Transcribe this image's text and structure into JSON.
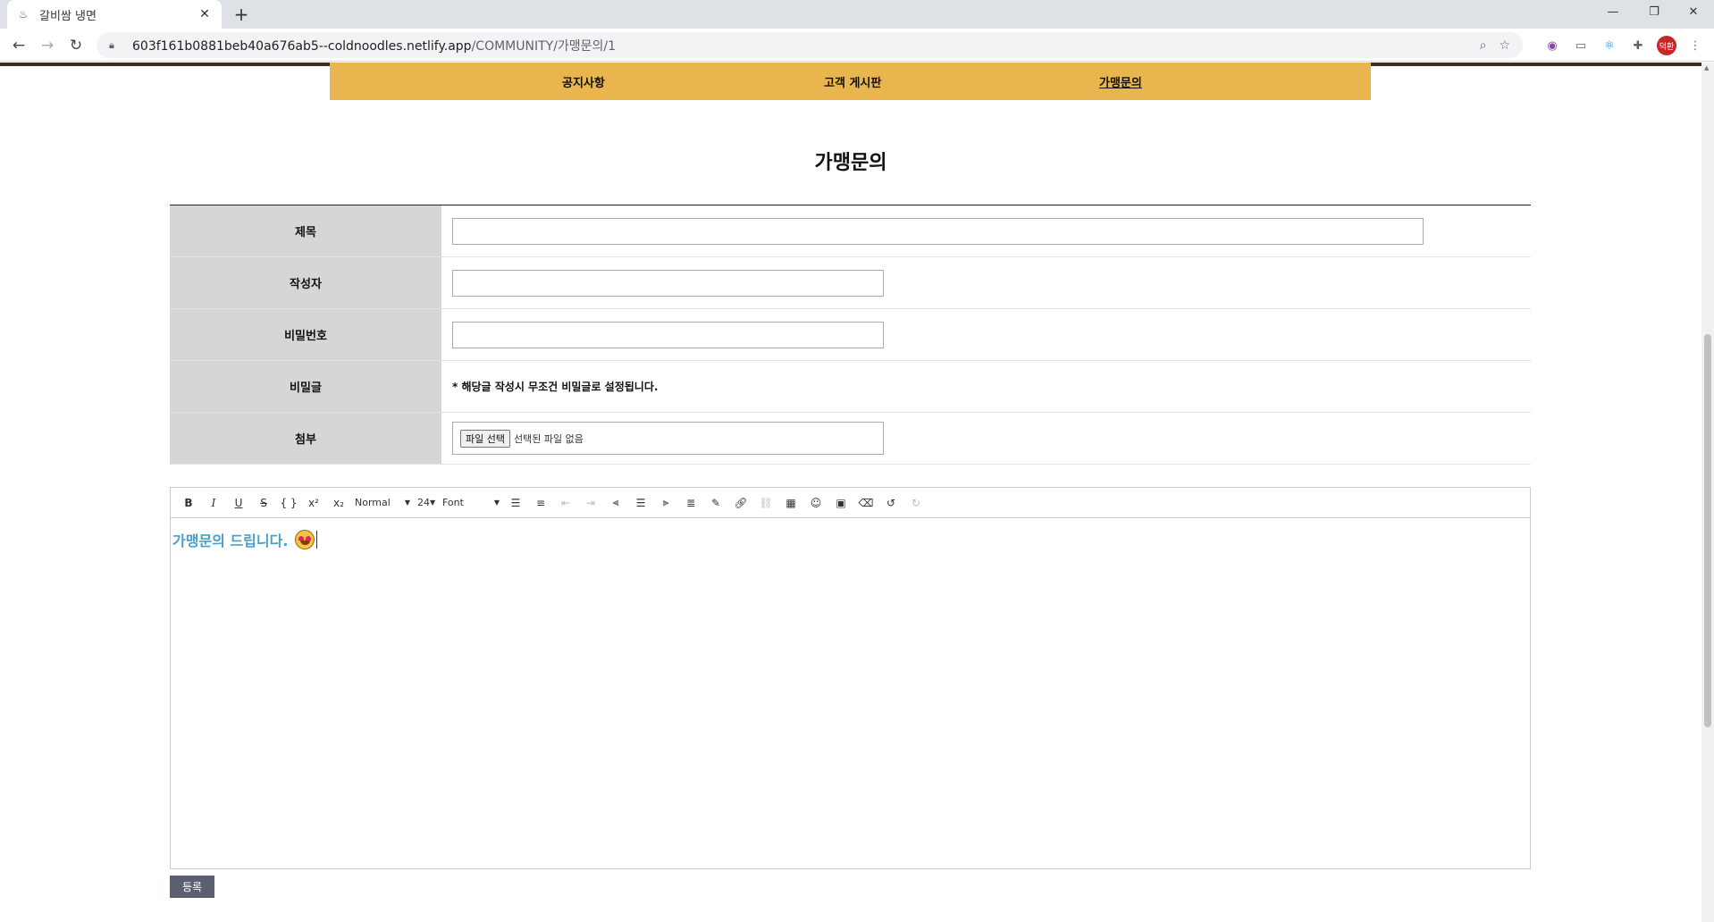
{
  "browser": {
    "tab_title": "갈비쌈 냉면",
    "url_domain": "603f161b0881beb40a676ab5--coldnoodles.netlify.app",
    "url_path": "/COMMUNITY/가맹문의/1",
    "profile_label": "덕환"
  },
  "subnav": {
    "items": [
      {
        "label": "공지사항"
      },
      {
        "label": "고객 게시판"
      },
      {
        "label": "가맹문의"
      }
    ]
  },
  "page": {
    "title": "가맹문의"
  },
  "form": {
    "title_label": "제목",
    "title_value": "",
    "author_label": "작성자",
    "author_value": "",
    "password_label": "비밀번호",
    "password_value": "",
    "secret_label": "비밀글",
    "secret_notice": "* 해당글 작성시 무조건 비밀글로 설정됩니다.",
    "attach_label": "첨부",
    "file_button": "파일 선택",
    "file_status": "선택된 파일 없음"
  },
  "editor": {
    "header_value": "Normal",
    "size_value": "24",
    "font_value": "Font",
    "content": "가맹문의 드립니다."
  },
  "submit_label": "등록"
}
